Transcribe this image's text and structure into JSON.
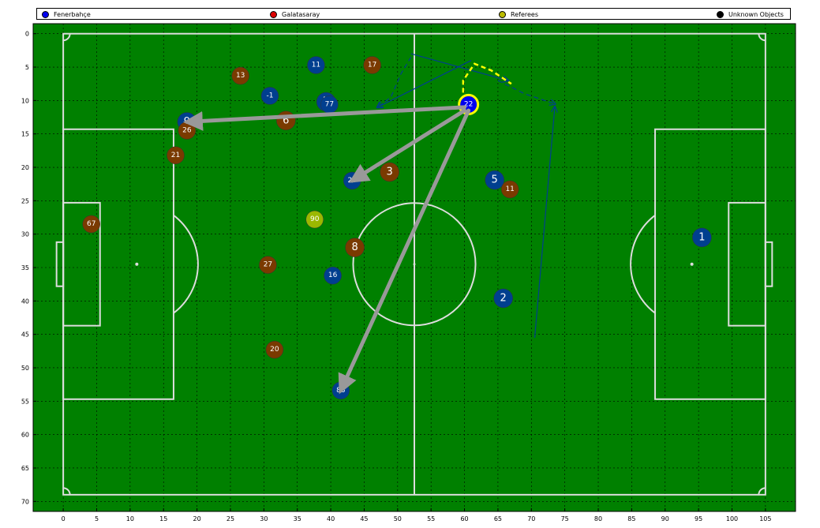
{
  "legend": {
    "items": [
      {
        "label": "Fenerbahçe",
        "color": "#0000ee"
      },
      {
        "label": "Galatasaray",
        "color": "#dd0000"
      },
      {
        "label": "Referees",
        "color": "#bbbb00"
      },
      {
        "label": "Unknown Objects",
        "color": "#000000"
      }
    ]
  },
  "chart_data": {
    "type": "scatter",
    "title": "",
    "xlabel": "",
    "ylabel": "",
    "xlim": [
      -4.5,
      109.5
    ],
    "ylim": [
      71.5,
      -1.5
    ],
    "y_inverted": true,
    "xticks": [
      0,
      5,
      10,
      15,
      20,
      25,
      30,
      35,
      40,
      45,
      50,
      55,
      60,
      65,
      70,
      75,
      80,
      85,
      90,
      95,
      100,
      105
    ],
    "yticks": [
      0,
      5,
      10,
      15,
      20,
      25,
      30,
      35,
      40,
      45,
      50,
      55,
      60,
      65,
      70
    ],
    "grid": true,
    "background": "#008000",
    "series": [
      {
        "name": "Fenerbahçe",
        "color": "#003f8f",
        "points": [
          {
            "label": "11",
            "x": 37.8,
            "y": 4.7
          },
          {
            "label": "-1",
            "x": 30.9,
            "y": 9.3
          },
          {
            "label": "7",
            "x": 39.3,
            "y": 10.2
          },
          {
            "label": "77",
            "x": 39.8,
            "y": 10.6
          },
          {
            "label": "9",
            "x": 18.5,
            "y": 13.2
          },
          {
            "label": "25",
            "x": 43.2,
            "y": 22.0
          },
          {
            "label": "5",
            "x": 64.5,
            "y": 21.9
          },
          {
            "label": "16",
            "x": 40.3,
            "y": 36.2
          },
          {
            "label": "2",
            "x": 65.8,
            "y": 39.6
          },
          {
            "label": "88",
            "x": 41.5,
            "y": 53.4
          },
          {
            "label": "1",
            "x": 95.5,
            "y": 30.5
          },
          {
            "label": "22",
            "x": 60.6,
            "y": 10.6
          }
        ]
      },
      {
        "name": "Galatasaray",
        "color": "#7a3a00",
        "points": [
          {
            "label": "13",
            "x": 26.5,
            "y": 6.3
          },
          {
            "label": "17",
            "x": 46.2,
            "y": 4.7
          },
          {
            "label": "6",
            "x": 33.3,
            "y": 13.0
          },
          {
            "label": "26",
            "x": 18.5,
            "y": 14.5
          },
          {
            "label": "21",
            "x": 16.8,
            "y": 18.2
          },
          {
            "label": "3",
            "x": 48.8,
            "y": 20.7
          },
          {
            "label": "11",
            "x": 66.8,
            "y": 23.3
          },
          {
            "label": "67",
            "x": 4.2,
            "y": 28.5
          },
          {
            "label": "8",
            "x": 43.6,
            "y": 32.0
          },
          {
            "label": "27",
            "x": 30.6,
            "y": 34.6
          },
          {
            "label": "20",
            "x": 31.6,
            "y": 47.3
          }
        ]
      },
      {
        "name": "Referees",
        "color": "#9bb800",
        "points": [
          {
            "label": "90",
            "x": 37.6,
            "y": 27.8
          }
        ]
      }
    ],
    "passes": [
      {
        "from": [
          60.0,
          11.0
        ],
        "to": [
          18.5,
          13.2
        ]
      },
      {
        "from": [
          60.0,
          11.5
        ],
        "to": [
          43.2,
          22.0
        ]
      },
      {
        "from": [
          60.6,
          11.5
        ],
        "to": [
          41.5,
          53.4
        ]
      }
    ],
    "movement_lines": [
      {
        "style": "dashed",
        "color": "#003f8f",
        "points": [
          [
            52.0,
            3.5
          ],
          [
            50.5,
            6.0
          ],
          [
            49.0,
            9.5
          ],
          [
            47.0,
            11.0
          ]
        ]
      },
      {
        "style": "solid",
        "color": "#003f8f",
        "points": [
          [
            61.0,
            4.0
          ],
          [
            47.0,
            11.0
          ]
        ]
      },
      {
        "style": "solid",
        "color": "#003f8f",
        "points": [
          [
            52.0,
            3.0
          ],
          [
            66.5,
            7.0
          ]
        ]
      },
      {
        "style": "dashed",
        "color": "#003f8f",
        "points": [
          [
            65.0,
            7.0
          ],
          [
            69.0,
            9.0
          ],
          [
            73.5,
            10.5
          ]
        ]
      },
      {
        "style": "solid",
        "color": "#003f8f",
        "points": [
          [
            70.5,
            45.5
          ],
          [
            73.5,
            11.0
          ]
        ]
      },
      {
        "style": "dashed",
        "color": "#ffff00",
        "points": [
          [
            59.8,
            10.0
          ],
          [
            59.8,
            7.0
          ],
          [
            61.5,
            4.5
          ],
          [
            64.0,
            5.5
          ],
          [
            67.0,
            7.5
          ]
        ]
      }
    ],
    "highlighted_player": "22"
  }
}
